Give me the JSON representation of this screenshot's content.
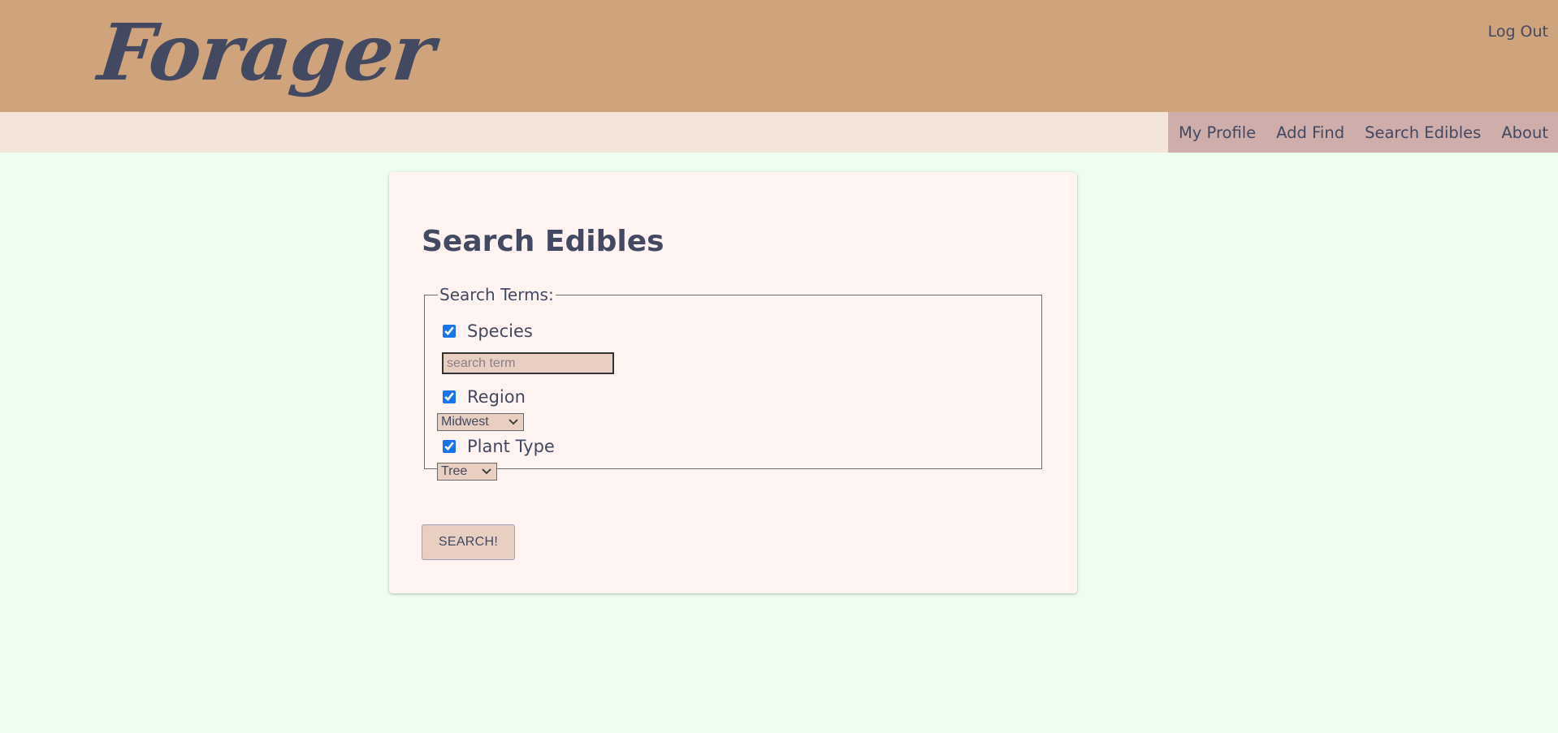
{
  "app": {
    "logo": "Forager"
  },
  "header": {
    "logout_label": "Log Out"
  },
  "nav": {
    "items": [
      {
        "label": "My Profile"
      },
      {
        "label": "Add Find"
      },
      {
        "label": "Search Edibles"
      },
      {
        "label": "About"
      }
    ]
  },
  "search": {
    "title": "Search Edibles",
    "legend": "Search Terms:",
    "species": {
      "label": "Species",
      "checked": true,
      "placeholder": "search term",
      "value": ""
    },
    "region": {
      "label": "Region",
      "checked": true,
      "selected": "Midwest"
    },
    "plant_type": {
      "label": "Plant Type",
      "checked": true,
      "selected": "Tree"
    },
    "submit_label": "SEARCH!"
  },
  "colors": {
    "header_bg": "#cfa47d",
    "navbar_bg": "#f2e4d6",
    "nav_links_bg": "#cfadab",
    "page_bg": "#edfdee",
    "card_bg": "#fff4f2",
    "text": "#424961",
    "input_bg": "#e8cfc2"
  }
}
